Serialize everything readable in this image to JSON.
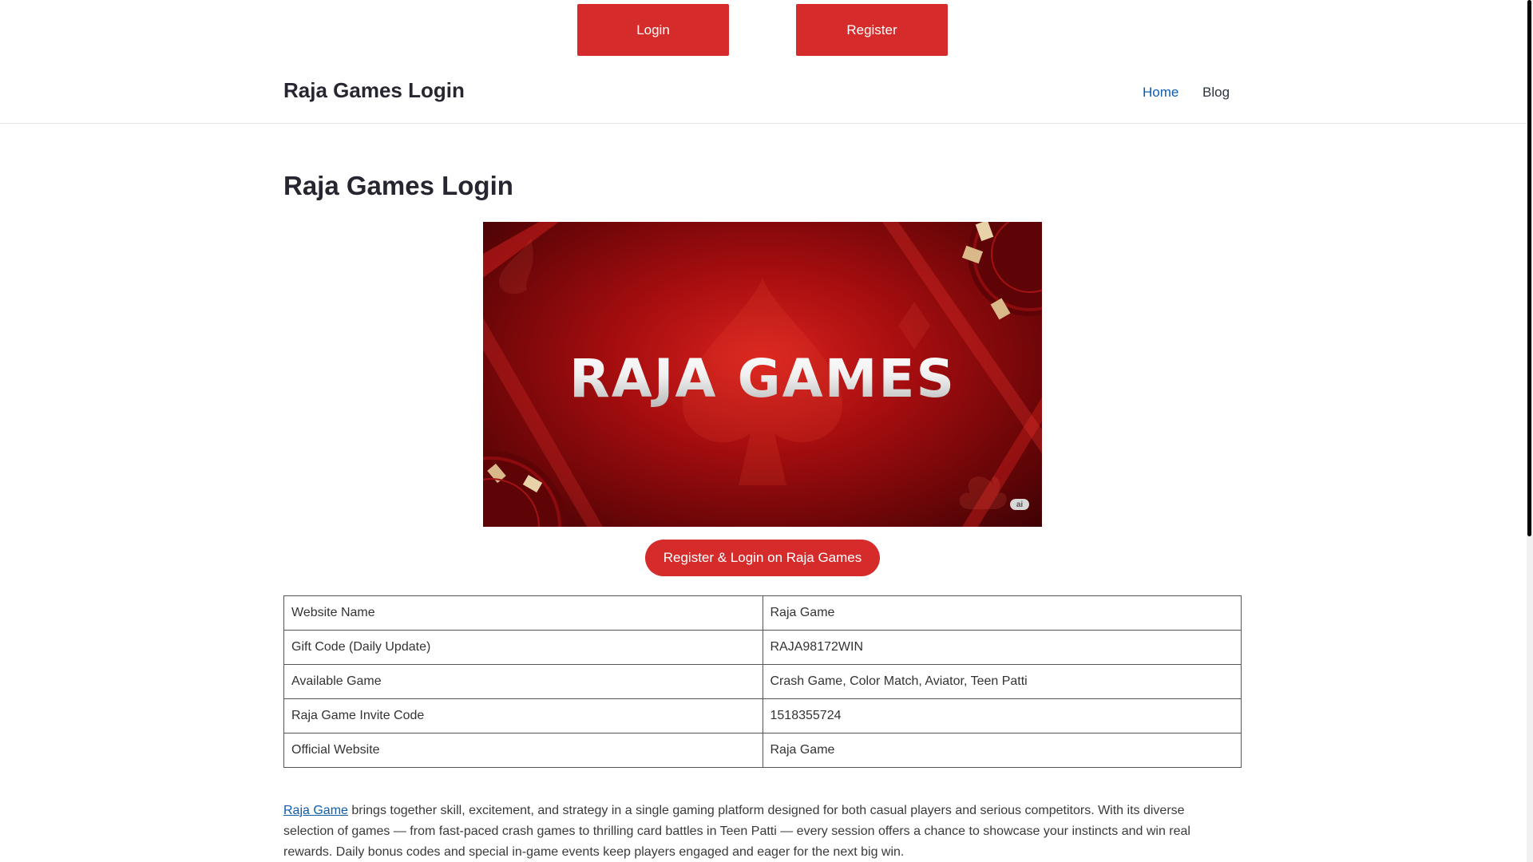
{
  "cta": {
    "login_label": "Login",
    "register_label": "Register"
  },
  "header": {
    "site_title": "Raja Games Login",
    "nav": [
      {
        "label": "Home"
      },
      {
        "label": "Blog"
      }
    ]
  },
  "main": {
    "title": "Raja Games Login",
    "hero": {
      "banner_text": "RAJA GAMES",
      "badge": "ai"
    },
    "pill_button": "Register & Login on Raja Games",
    "table": [
      [
        "Website Name",
        "Raja Game"
      ],
      [
        "Gift Code (Daily Update)",
        "RAJA98172WIN"
      ],
      [
        "Available Game",
        "Crash Game, Color Match, Aviator, Teen Patti"
      ],
      [
        "Raja Game Invite Code",
        "1518355724"
      ],
      [
        "Official Website",
        "Raja Game"
      ]
    ],
    "paragraph": {
      "link_text": "Raja Game",
      "text": " brings together skill, excitement, and strategy in a single gaming platform designed for both casual players and serious competitors. With its diverse selection of games — from fast-paced crash games to thrilling card battles in Teen Patti — every session offers a chance to showcase your instincts and win real rewards. Daily bonus codes and special in-game events keep players engaged and eager for the next big win."
    }
  },
  "colors": {
    "accent": "#d52b2b",
    "link": "#0f5cab",
    "text": "#262630"
  }
}
